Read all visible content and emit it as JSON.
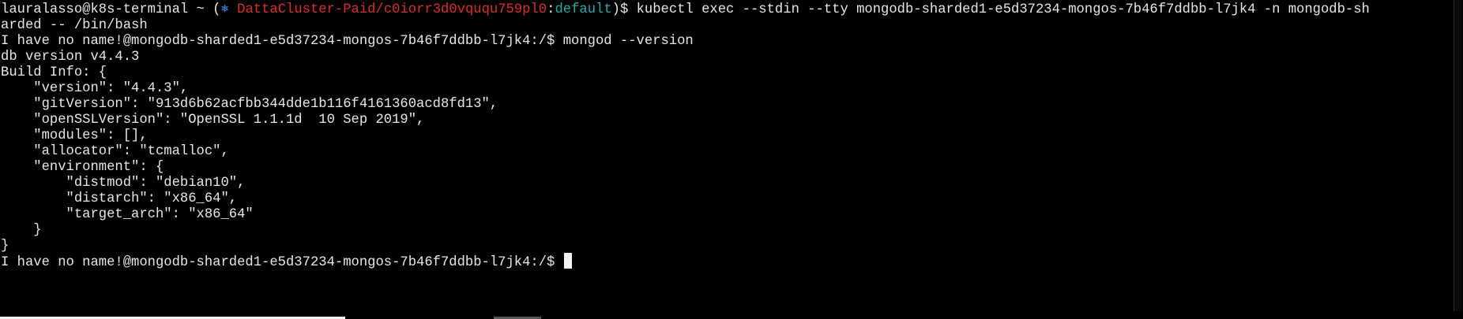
{
  "terminal": {
    "prompt_user_host": "lauralasso@k8s-terminal ~ (",
    "context_icon": "⎈",
    "context_cluster": " DattaCluster-Paid/c0iorr3d0vququ759pl0",
    "context_sep": ":",
    "context_namespace": "default",
    "prompt_end": ")$ ",
    "command_1": "kubectl exec --stdin --tty mongodb-sharded1-e5d37234-mongos-7b46f7ddbb-l7jk4 -n mongodb-sh",
    "command_1_wrap": "arded -- /bin/bash",
    "pod_prompt": "I have no name!@mongodb-sharded1-e5d37234-mongos-7b46f7ddbb-l7jk4:/$ ",
    "command_2": "mongod --version",
    "output": [
      "db version v4.4.3",
      "Build Info: {",
      "    \"version\": \"4.4.3\",",
      "    \"gitVersion\": \"913d6b62acfbb344dde1b116f4161360acd8fd13\",",
      "    \"openSSLVersion\": \"OpenSSL 1.1.1d  10 Sep 2019\",",
      "    \"modules\": [],",
      "    \"allocator\": \"tcmalloc\",",
      "    \"environment\": {",
      "        \"distmod\": \"debian10\",",
      "        \"distarch\": \"x86_64\",",
      "        \"target_arch\": \"x86_64\"",
      "    }",
      "}"
    ],
    "final_prompt": "I have no name!@mongodb-sharded1-e5d37234-mongos-7b46f7ddbb-l7jk4:/$ "
  },
  "colors": {
    "background": "#000000",
    "text": "#e6e6e6",
    "cluster": "#d62f2f",
    "namespace": "#2aa7a7",
    "icon": "#3d7fd9"
  }
}
